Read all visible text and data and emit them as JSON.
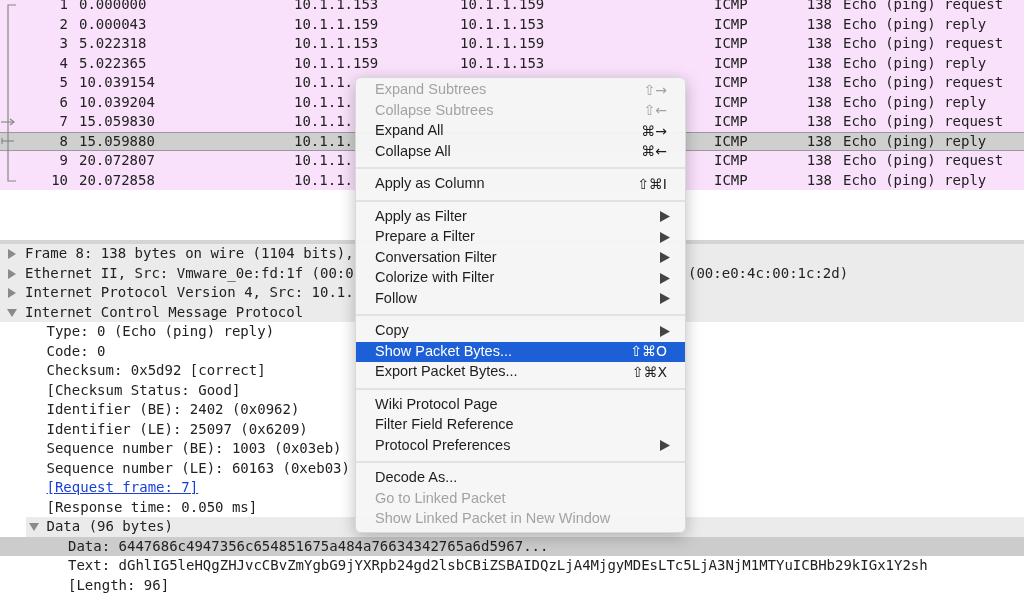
{
  "packet_list": {
    "rows": [
      {
        "no": "1",
        "time": "0.000000",
        "source": "10.1.1.153",
        "destination": "10.1.1.159",
        "protocol": "ICMP",
        "length": "138",
        "info": "Echo (ping) request",
        "selected": false
      },
      {
        "no": "2",
        "time": "0.000043",
        "source": "10.1.1.159",
        "destination": "10.1.1.153",
        "protocol": "ICMP",
        "length": "138",
        "info": "Echo (ping) reply",
        "selected": false
      },
      {
        "no": "3",
        "time": "5.022318",
        "source": "10.1.1.153",
        "destination": "10.1.1.159",
        "protocol": "ICMP",
        "length": "138",
        "info": "Echo (ping) request",
        "selected": false
      },
      {
        "no": "4",
        "time": "5.022365",
        "source": "10.1.1.159",
        "destination": "10.1.1.153",
        "protocol": "ICMP",
        "length": "138",
        "info": "Echo (ping) reply",
        "selected": false
      },
      {
        "no": "5",
        "time": "10.039154",
        "source": "10.1.1.",
        "protocol": "ICMP",
        "length": "138",
        "info": "Echo (ping) request",
        "selected": false
      },
      {
        "no": "6",
        "time": "10.039204",
        "source": "10.1.1.",
        "protocol": "ICMP",
        "length": "138",
        "info": "Echo (ping) reply",
        "selected": false
      },
      {
        "no": "7",
        "time": "15.059830",
        "source": "10.1.1.",
        "protocol": "ICMP",
        "length": "138",
        "info": "Echo (ping) request",
        "selected": false
      },
      {
        "no": "8",
        "time": "15.059880",
        "source": "10.1.1.",
        "protocol": "ICMP",
        "length": "138",
        "info": "Echo (ping) reply",
        "selected": true
      },
      {
        "no": "9",
        "time": "20.072807",
        "source": "10.1.1.",
        "protocol": "ICMP",
        "length": "138",
        "info": "Echo (ping) request",
        "selected": false
      },
      {
        "no": "10",
        "time": "20.072858",
        "source": "10.1.1.",
        "protocol": "ICMP",
        "length": "138",
        "info": "Echo (ping) reply",
        "selected": false
      }
    ]
  },
  "details": [
    {
      "text": "Frame 8: 138 bytes on wire (1104 bits),",
      "expanded": false
    },
    {
      "text": "Ethernet II, Src: Vmware_0e:fd:1f (00:0",
      "text_after_menu": "(00:e0:4c:00:1c:2d)",
      "expanded": false
    },
    {
      "text": "Internet Protocol Version 4, Src: 10.1.",
      "expanded": false
    },
    {
      "text": "Internet Control Message Protocol",
      "expanded": true,
      "children": [
        {
          "text": "Type: 0 (Echo (ping) reply)"
        },
        {
          "text": "Code: 0"
        },
        {
          "text": "Checksum: 0x5d92 [correct]"
        },
        {
          "text": "[Checksum Status: Good]"
        },
        {
          "text": "Identifier (BE): 2402 (0x0962)"
        },
        {
          "text": "Identifier (LE): 25097 (0x6209)"
        },
        {
          "text": "Sequence number (BE): 1003 (0x03eb)"
        },
        {
          "text": "Sequence number (LE): 60163 (0xeb03)"
        },
        {
          "text": "[Request frame: 7]",
          "kind": "link"
        },
        {
          "text": "[Response time: 0.050 ms]"
        },
        {
          "text": "Data (96 bytes)",
          "expanded": true,
          "children": [
            {
              "text": "Data: 6447686c4947356c654851675a484a76634342765a6d5967...",
              "selected": true
            },
            {
              "text": "Text: dGhlIG5leHQgZHJvcCBvZmYgbG9jYXRpb24gd2lsbCBiZSBAIDQzLjA4MjgyMDEsLTc5LjA3NjM1MTYuICBHb29kIGx1Y2sh"
            },
            {
              "text": "[Length: 96]"
            }
          ]
        }
      ]
    }
  ],
  "context_menu": [
    {
      "kind": "item",
      "label": "Expand Subtrees",
      "shortcut": "⇧→",
      "disabled": true,
      "submenu": false,
      "selected": false
    },
    {
      "kind": "item",
      "label": "Collapse Subtrees",
      "shortcut": "⇧←",
      "disabled": true,
      "submenu": false,
      "selected": false
    },
    {
      "kind": "item",
      "label": "Expand All",
      "shortcut": "⌘→",
      "disabled": false,
      "submenu": false,
      "selected": false
    },
    {
      "kind": "item",
      "label": "Collapse All",
      "shortcut": "⌘←",
      "disabled": false,
      "submenu": false,
      "selected": false
    },
    {
      "kind": "separator"
    },
    {
      "kind": "item",
      "label": "Apply as Column",
      "shortcut": "⇧⌘I",
      "disabled": false,
      "submenu": false,
      "selected": false
    },
    {
      "kind": "separator"
    },
    {
      "kind": "item",
      "label": "Apply as Filter",
      "disabled": false,
      "submenu": true,
      "selected": false
    },
    {
      "kind": "item",
      "label": "Prepare a Filter",
      "disabled": false,
      "submenu": true,
      "selected": false
    },
    {
      "kind": "item",
      "label": "Conversation Filter",
      "disabled": false,
      "submenu": true,
      "selected": false
    },
    {
      "kind": "item",
      "label": "Colorize with Filter",
      "disabled": false,
      "submenu": true,
      "selected": false
    },
    {
      "kind": "item",
      "label": "Follow",
      "disabled": false,
      "submenu": true,
      "selected": false
    },
    {
      "kind": "separator"
    },
    {
      "kind": "item",
      "label": "Copy",
      "disabled": false,
      "submenu": true,
      "selected": false
    },
    {
      "kind": "item",
      "label": "Show Packet Bytes...",
      "shortcut": "⇧⌘O",
      "disabled": false,
      "submenu": false,
      "selected": true
    },
    {
      "kind": "item",
      "label": "Export Packet Bytes...",
      "shortcut": "⇧⌘X",
      "disabled": false,
      "submenu": false,
      "selected": false
    },
    {
      "kind": "separator"
    },
    {
      "kind": "item",
      "label": "Wiki Protocol Page",
      "disabled": false,
      "submenu": false,
      "selected": false
    },
    {
      "kind": "item",
      "label": "Filter Field Reference",
      "disabled": false,
      "submenu": false,
      "selected": false
    },
    {
      "kind": "item",
      "label": "Protocol Preferences",
      "disabled": false,
      "submenu": true,
      "selected": false
    },
    {
      "kind": "separator"
    },
    {
      "kind": "item",
      "label": "Decode As...",
      "disabled": false,
      "submenu": false,
      "selected": false
    },
    {
      "kind": "item",
      "label": "Go to Linked Packet",
      "disabled": true,
      "submenu": false,
      "selected": false
    },
    {
      "kind": "item",
      "label": "Show Linked Packet in New Window",
      "disabled": true,
      "submenu": false,
      "selected": false
    }
  ]
}
